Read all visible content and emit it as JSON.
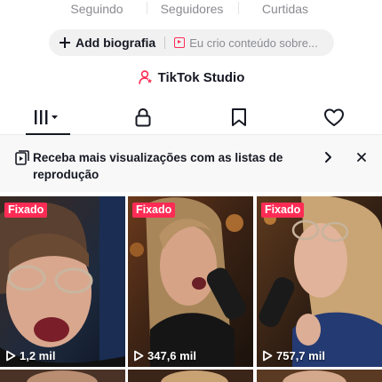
{
  "profile_stats": [
    {
      "label": "Seguindo"
    },
    {
      "label": "Seguidores"
    },
    {
      "label": "Curtidas"
    }
  ],
  "actions": {
    "add_bio_label": "Add biografia",
    "content_placeholder": "Eu crio conteúdo sobre..."
  },
  "studio": {
    "label": "TikTok Studio"
  },
  "tabs": [
    {
      "icon": "videos-grid-icon",
      "active": true
    },
    {
      "icon": "lock-icon",
      "active": false
    },
    {
      "icon": "bookmark-icon",
      "active": false
    },
    {
      "icon": "heart-icon",
      "active": false
    }
  ],
  "banner": {
    "text": "Receba mais visualizações com as listas de reprodução"
  },
  "videos": [
    {
      "pinned_label": "Fixado",
      "views": "1,2 mil"
    },
    {
      "pinned_label": "Fixado",
      "views": "347,6 mil"
    },
    {
      "pinned_label": "Fixado",
      "views": "757,7 mil"
    }
  ],
  "colors": {
    "accent": "#fe2c55",
    "text": "#161823",
    "muted": "#8a8b91"
  }
}
